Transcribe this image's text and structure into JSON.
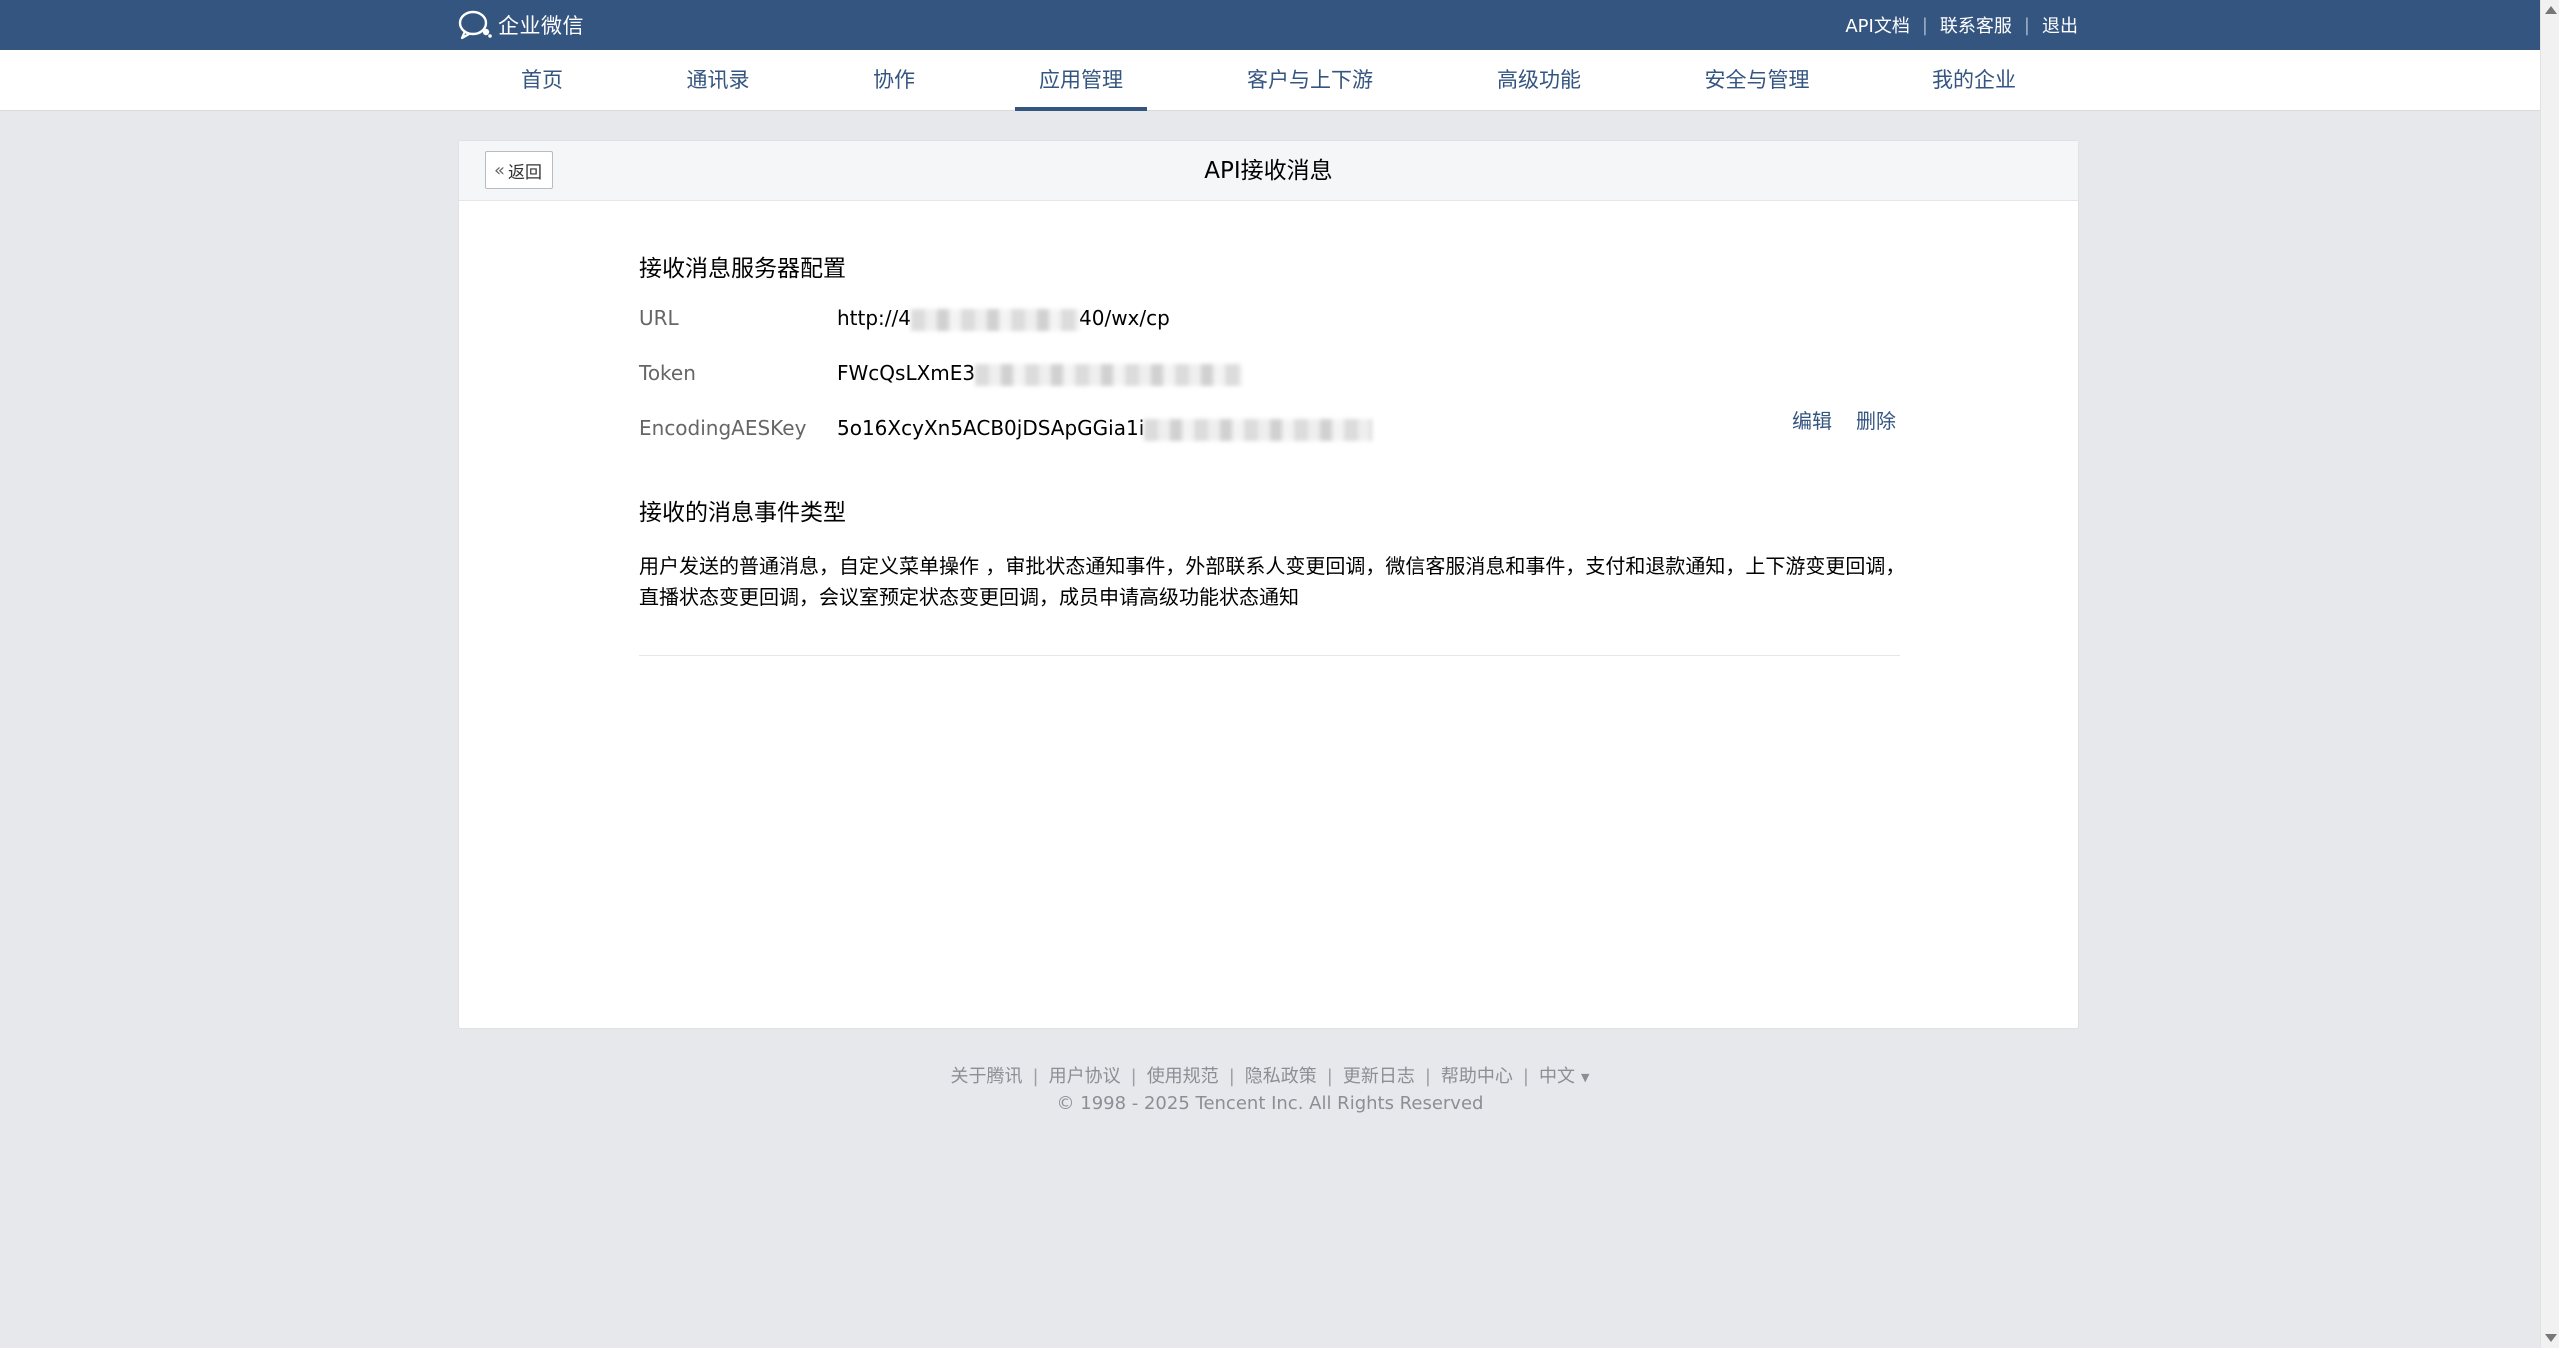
{
  "brand": {
    "name": "企业微信",
    "icon": "wecom-chat-icon"
  },
  "toplinks": {
    "api_docs": "API文档",
    "support": "联系客服",
    "logout": "退出",
    "separator": "|"
  },
  "nav": {
    "active": "应用管理",
    "items": [
      "首页",
      "通讯录",
      "协作",
      "应用管理",
      "客户与上下游",
      "高级功能",
      "安全与管理",
      "我的企业"
    ]
  },
  "page": {
    "back_label": "返回",
    "back_icon": "double-chevron-left-icon",
    "title": "API接收消息"
  },
  "server_config": {
    "title": "接收消息服务器配置",
    "url_label": "URL",
    "url_value_start": "http://4",
    "url_value_end": "40/wx/cp",
    "token_label": "Token",
    "token_value": "FWcQsLXmE3",
    "aeskey_label": "EncodingAESKey",
    "aeskey_value": "5o16XcyXn5ACB0jDSApGGia1i",
    "edit_label": "编辑",
    "delete_label": "删除"
  },
  "event_types": {
    "title": "接收的消息事件类型",
    "description": "用户发送的普通消息，自定义菜单操作 ，审批状态通知事件，外部联系人变更回调，微信客服消息和事件，支付和退款通知，上下游变更回调，直播状态变更回调，会议室预定状态变更回调，成员申请高级功能状态通知"
  },
  "footer": {
    "links": [
      "关于腾讯",
      "用户协议",
      "使用规范",
      "隐私政策",
      "更新日志",
      "帮助中心"
    ],
    "language": "中文",
    "separator": "|",
    "copyright": "© 1998 - 2025 Tencent Inc. All Rights Reserved"
  },
  "colors": {
    "brand": "#355581",
    "background": "#e7e8eb",
    "card": "#ffffff"
  }
}
